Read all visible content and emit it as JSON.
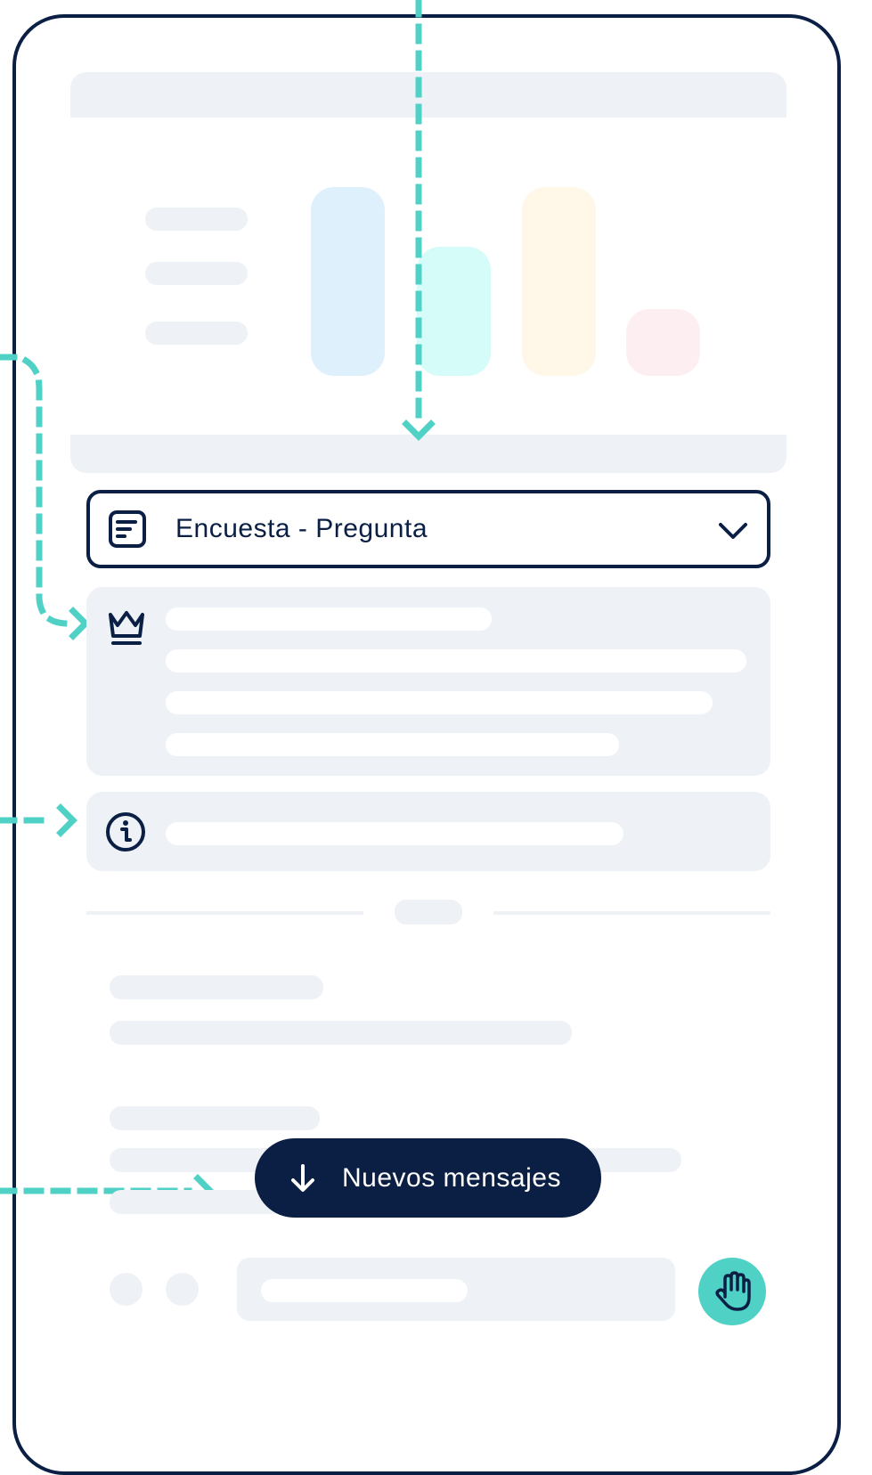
{
  "selector": {
    "label": "Encuesta - Pregunta",
    "icon": "survey-document-icon",
    "dropdown_icon": "chevron-down-icon"
  },
  "highlight_card": {
    "icon": "crown-icon"
  },
  "info_card": {
    "icon": "info-icon"
  },
  "new_messages_button": {
    "label": "Nuevos mensajes",
    "icon": "arrow-down-icon"
  },
  "raise_hand_button": {
    "icon": "raised-hand-icon"
  },
  "colors": {
    "navy": "#0b1f45",
    "teal": "#4fd1c5",
    "skeleton": "#eef1f6",
    "bar_blue": "#dff0fd",
    "bar_teal": "#d5fcf8",
    "bar_yellow": "#fff7e7",
    "bar_pink": "#fdeff1"
  }
}
